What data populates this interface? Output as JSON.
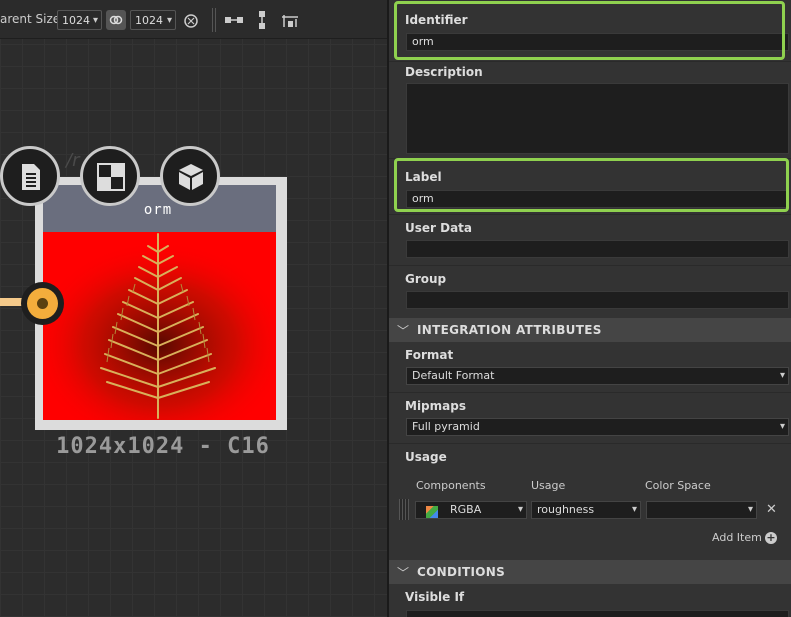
{
  "toolbar": {
    "parent_size_label": "arent Size:",
    "width_value": "1024",
    "height_value": "1024",
    "link_icon": "link-icon",
    "reset_icon": "reset-icon"
  },
  "node": {
    "title": "orm",
    "status": "1024x1024 - C16",
    "ghost_text": "/r  es",
    "thumbnail": "fern-icon",
    "colors": {
      "thumb_bg": "#ff0000",
      "port": "#f3ad3c",
      "wire": "#f4c98a"
    }
  },
  "properties": {
    "identifier": {
      "label": "Identifier",
      "value": "orm"
    },
    "description": {
      "label": "Description",
      "value": ""
    },
    "label": {
      "label": "Label",
      "value": "orm"
    },
    "user_data": {
      "label": "User Data",
      "value": ""
    },
    "group": {
      "label": "Group",
      "value": ""
    }
  },
  "integration": {
    "title": "INTEGRATION ATTRIBUTES",
    "format": {
      "label": "Format",
      "value": "Default Format"
    },
    "mipmaps": {
      "label": "Mipmaps",
      "value": "Full pyramid"
    },
    "usage": {
      "label": "Usage",
      "columns": [
        "Components",
        "Usage",
        "Color Space"
      ],
      "row": {
        "components": "RGBA",
        "usage": "roughness",
        "color_space": ""
      },
      "add_item": "Add Item"
    }
  },
  "conditions": {
    "title": "CONDITIONS",
    "visible_if": {
      "label": "Visible If"
    }
  },
  "accent": "#8fd14f"
}
